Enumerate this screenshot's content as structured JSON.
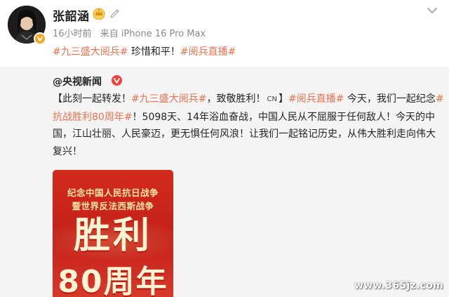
{
  "post": {
    "author": "张韶涵",
    "time": "16小时前",
    "source": "来自 iPhone 16 Pro Max",
    "text_topic_1": "#九三盛大阅兵#",
    "text_middle": " 珍惜和平！",
    "text_topic_2": "#阅兵直播#"
  },
  "repost": {
    "author": "@央视新闻",
    "body": {
      "open_bracket": "【此刻一起转发！",
      "topic_1": "#九三盛大阅兵#",
      "after_topic_1": "，致敬胜利！",
      "cn_label": "CN",
      "close_bracket": "】",
      "topic_2": "#阅兵直播#",
      "after_topic_2": " 今天，我们一起纪念",
      "topic_3": "#抗战胜利80周年#",
      "rest": "！5098天、14年浴血奋战，中国人民从不屈服于任何敌人！今天的中国，江山壮丽、人民豪迈，更无惧任何风浪！让我们一起铭记历史，从伟大胜利走向伟大复兴！"
    },
    "poster": {
      "line1": "纪念中国人民抗日战争",
      "line2": "暨世界反法西斯战争",
      "big1": "胜利",
      "big2": "80周年"
    }
  },
  "watermark": "www.365jz.com",
  "colors": {
    "topic": "#eb7350",
    "repost_bg": "#f4f4f4",
    "poster_red": "#d22b1c",
    "poster_gold": "#ffe6a6"
  },
  "icons": {
    "crown": "crown-icon",
    "vip": "vip-icon",
    "verified": "verified-icon",
    "follow": "chevron-down-icon"
  }
}
